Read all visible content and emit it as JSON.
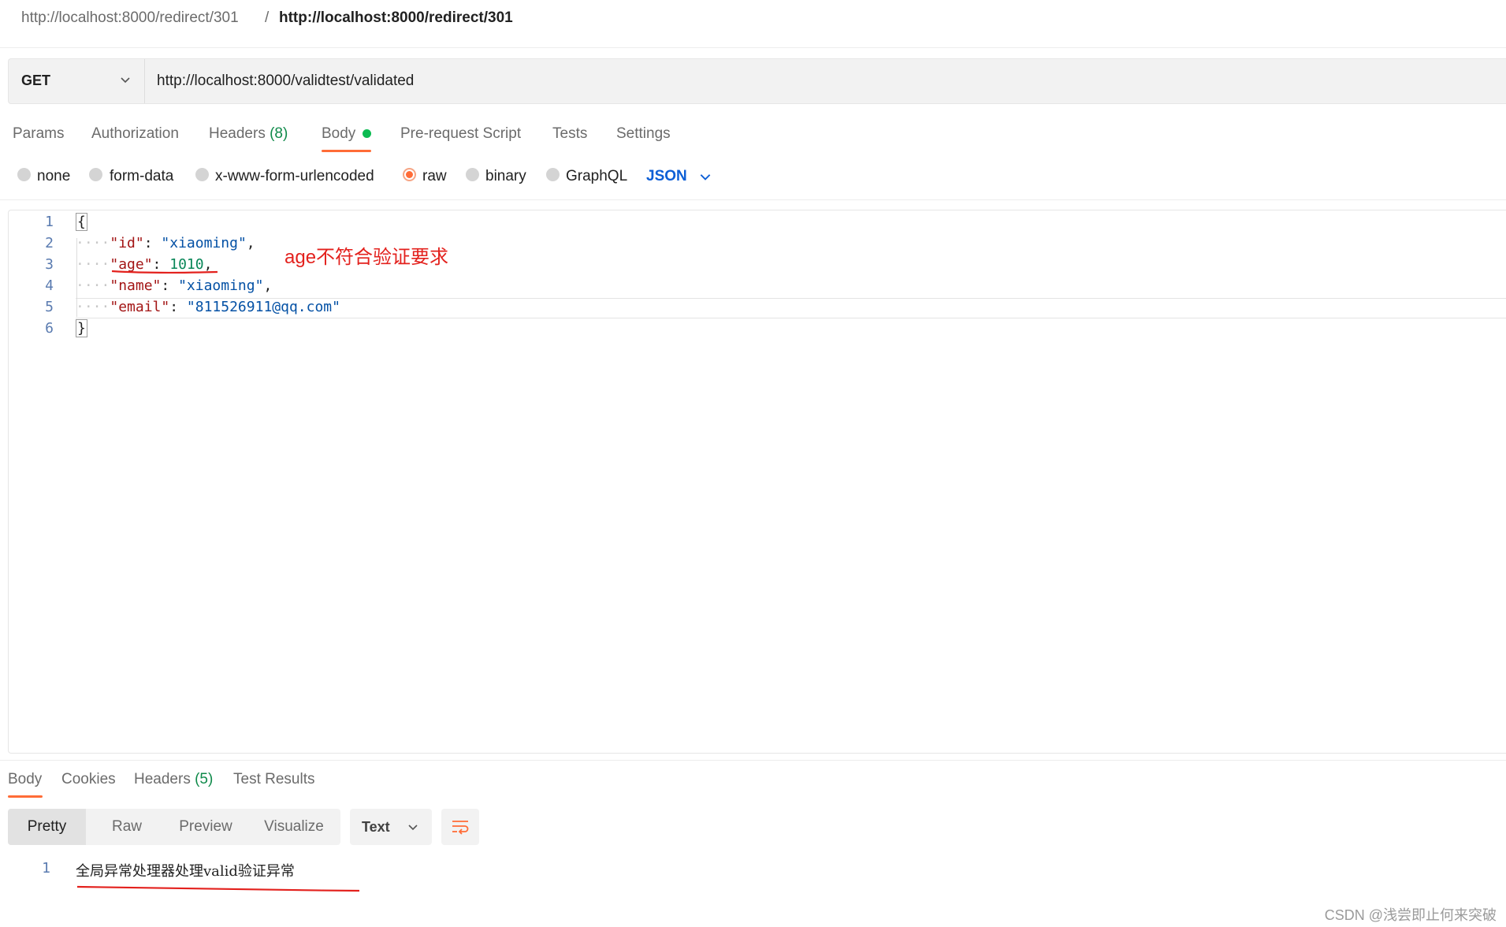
{
  "breadcrumb": {
    "parent": "http://localhost:8000/redirect/301",
    "separator": "/",
    "current": "http://localhost:8000/redirect/301"
  },
  "request": {
    "method": "GET",
    "url": "http://localhost:8000/validtest/validated"
  },
  "request_tabs": [
    {
      "label": "Params"
    },
    {
      "label": "Authorization"
    },
    {
      "label": "Headers",
      "count": "(8)"
    },
    {
      "label": "Body",
      "active": true
    },
    {
      "label": "Pre-request Script"
    },
    {
      "label": "Tests"
    },
    {
      "label": "Settings"
    }
  ],
  "body_types": {
    "options": [
      "none",
      "form-data",
      "x-www-form-urlencoded",
      "raw",
      "binary",
      "GraphQL"
    ],
    "selected": "raw",
    "format": "JSON"
  },
  "editor": {
    "line_numbers": [
      "1",
      "2",
      "3",
      "4",
      "5",
      "6"
    ],
    "lines": [
      {
        "open": "{"
      },
      {
        "key": "\"id\"",
        "colon": ": ",
        "value": "\"xiaoming\"",
        "trail": ","
      },
      {
        "key": "\"age\"",
        "colon": ": ",
        "value": "1010",
        "trail": ","
      },
      {
        "key": "\"name\"",
        "colon": ": ",
        "value": "\"xiaoming\"",
        "trail": ","
      },
      {
        "key": "\"email\"",
        "colon": ": ",
        "value": "\"811526911@qq.com\"",
        "trail": ""
      },
      {
        "close": "}"
      }
    ],
    "annotation": "age不符合验证要求"
  },
  "response": {
    "tabs": [
      {
        "label": "Body",
        "active": true
      },
      {
        "label": "Cookies"
      },
      {
        "label": "Headers",
        "count": "(5)"
      },
      {
        "label": "Test Results"
      }
    ],
    "views": [
      "Pretty",
      "Raw",
      "Preview",
      "Visualize"
    ],
    "active_view": "Pretty",
    "format": "Text",
    "line_number": "1",
    "body_text": "全局异常处理器处理valid验证异常"
  },
  "watermark": "CSDN @浅尝即止何来突破",
  "colors": {
    "accent": "#ff6c37",
    "link_blue": "#0d5fd6",
    "annotation_red": "#e3211d",
    "active_dot": "#0cbb52"
  }
}
